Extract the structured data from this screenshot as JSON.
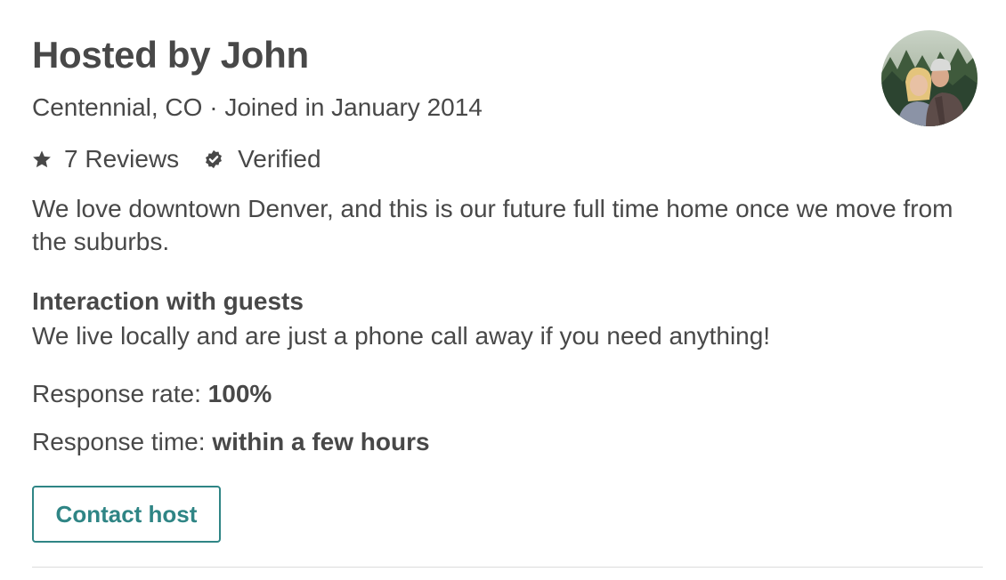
{
  "host": {
    "title": "Hosted by John",
    "subtitle": "Centennial, CO · Joined in January 2014",
    "reviews_label": "7 Reviews",
    "verified_label": "Verified",
    "about": "We love downtown Denver, and this is our future full time home once we move from the suburbs.",
    "avatar_icon": "host-avatar-photo"
  },
  "interaction": {
    "heading": "Interaction with guests",
    "body": "We live locally and are just a phone call away if you need anything!"
  },
  "response": {
    "rate_label": "Response rate: ",
    "rate_value": "100%",
    "time_label": "Response time: ",
    "time_value": "within a few hours"
  },
  "actions": {
    "contact_label": "Contact host"
  },
  "icons": {
    "reviews": "star-icon",
    "verified": "verified-badge-icon"
  },
  "colors": {
    "text": "#484848",
    "accent": "#2f8585",
    "divider": "#dcdcdc"
  }
}
